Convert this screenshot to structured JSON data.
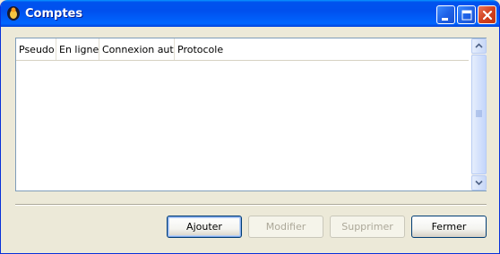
{
  "window": {
    "title": "Comptes",
    "controls": [
      "minimize-icon",
      "maximize-icon",
      "close-icon"
    ]
  },
  "list": {
    "columns": [
      "Pseudo",
      "En ligne",
      "Connexion auto",
      "Protocole"
    ],
    "rows": []
  },
  "buttons": {
    "add": "Ajouter",
    "modify": "Modifier",
    "delete": "Supprimer",
    "close": "Fermer"
  },
  "colors": {
    "titlebar": "#0053ee",
    "window_bg": "#ece9d8",
    "close_button": "#d3421f"
  }
}
